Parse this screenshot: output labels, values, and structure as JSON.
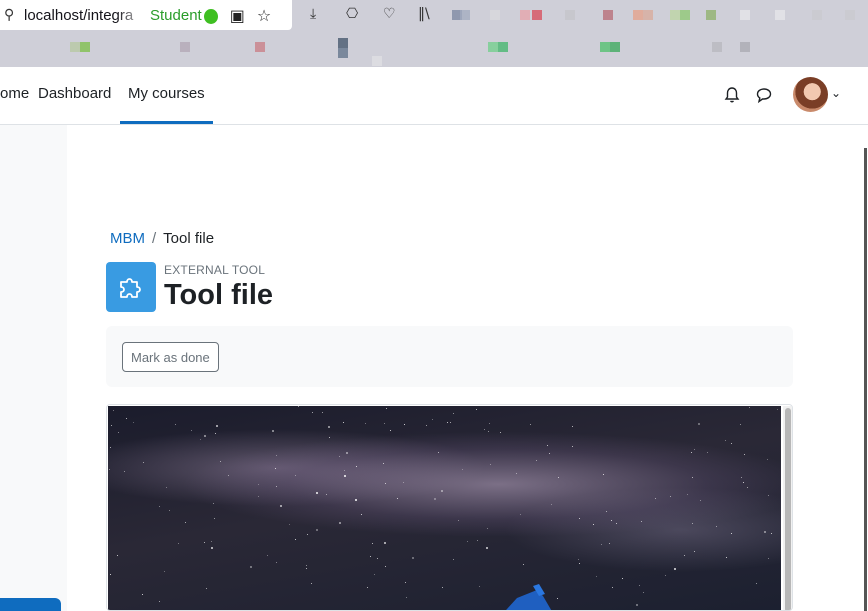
{
  "browser": {
    "url": "localhost/integra",
    "profile_tag": "Student",
    "icons": [
      "site-info-icon",
      "qr-icon",
      "bookmark-star-icon",
      "download-icon",
      "extensions-icon",
      "pocket-icon",
      "library-icon"
    ]
  },
  "navbar": {
    "items": [
      {
        "label": "ome",
        "active": false
      },
      {
        "label": "Dashboard",
        "active": false
      },
      {
        "label": "My courses",
        "active": true
      }
    ],
    "icons": [
      "bell-icon",
      "chat-icon",
      "chevron-down-icon"
    ]
  },
  "breadcrumb": {
    "course": "MBM",
    "separator": "/",
    "current": "Tool file"
  },
  "activity": {
    "type_label": "EXTERNAL TOOL",
    "title": "Tool file",
    "icon": "puzzle-icon"
  },
  "completion": {
    "button_label": "Mark as done"
  },
  "colors": {
    "primary": "#0f6cbf",
    "activity_icon_bg": "#399be2",
    "text": "#1d2125",
    "muted": "#6a737b"
  }
}
